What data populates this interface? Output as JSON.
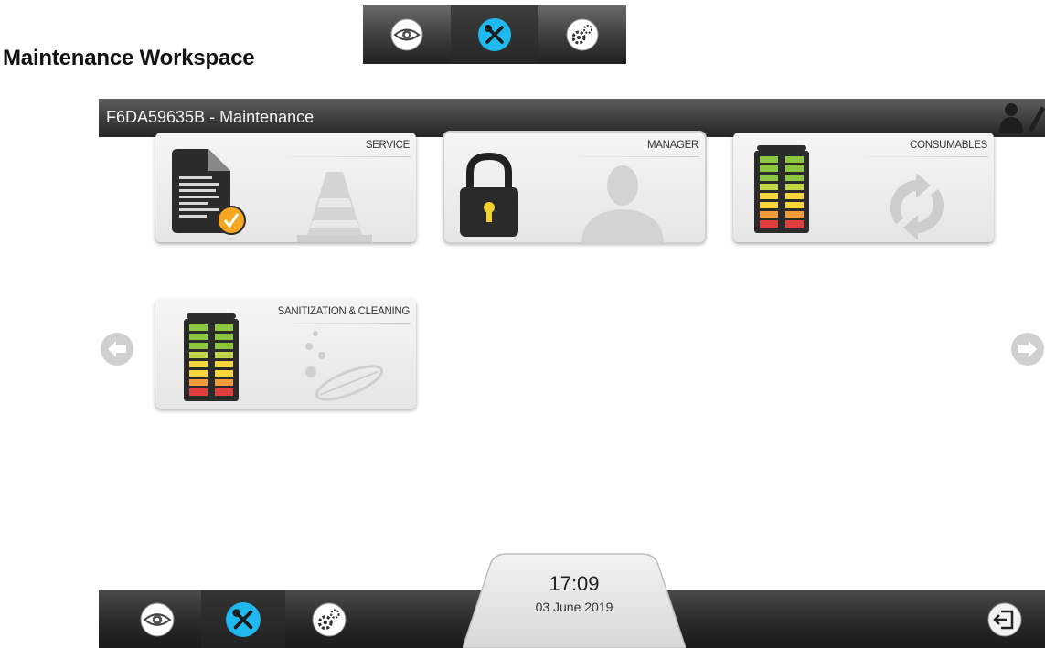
{
  "doc_title": "Maintenance Workspace",
  "legend_bar": {
    "buttons": [
      {
        "icon": "eye-icon",
        "active": false
      },
      {
        "icon": "tools-icon",
        "active": true
      },
      {
        "icon": "settings-gears-icon",
        "active": false
      }
    ]
  },
  "header": {
    "title": "F6DA59635B - Maintenance",
    "icons": [
      "user-icon",
      "edit-pencil-icon"
    ]
  },
  "tiles": [
    {
      "label": "SERVICE",
      "icon": "service-document-icon",
      "bg_icon": "traffic-cone-icon"
    },
    {
      "label": "MANAGER",
      "icon": "padlock-icon",
      "bg_icon": "person-silhouette-icon",
      "selected": true
    },
    {
      "label": "CONSUMABLES",
      "icon": "level-gauge-icon",
      "bg_icon": "refresh-cycle-icon"
    },
    {
      "label": "SANITIZATION & CLEANING",
      "icon": "level-gauge-icon",
      "bg_icon": "cleaning-tablet-icon"
    }
  ],
  "navigation": {
    "prev": "arrow-left-icon",
    "next": "arrow-right-icon"
  },
  "footer": {
    "buttons": [
      {
        "icon": "eye-icon",
        "active": false
      },
      {
        "icon": "tools-icon",
        "active": true
      },
      {
        "icon": "settings-gears-icon",
        "active": false
      }
    ],
    "time": "17:09",
    "date": "03 June 2019",
    "logout_icon": "logout-icon"
  },
  "colors": {
    "accent_cyan": "#1fb8ef",
    "header_dark": "#2a2a2a",
    "badge_orange": "#f5a623",
    "gauge_green": "#8dc63f",
    "gauge_yellow": "#f7d33c",
    "gauge_orange": "#f39c3c",
    "gauge_red": "#e0403a"
  }
}
